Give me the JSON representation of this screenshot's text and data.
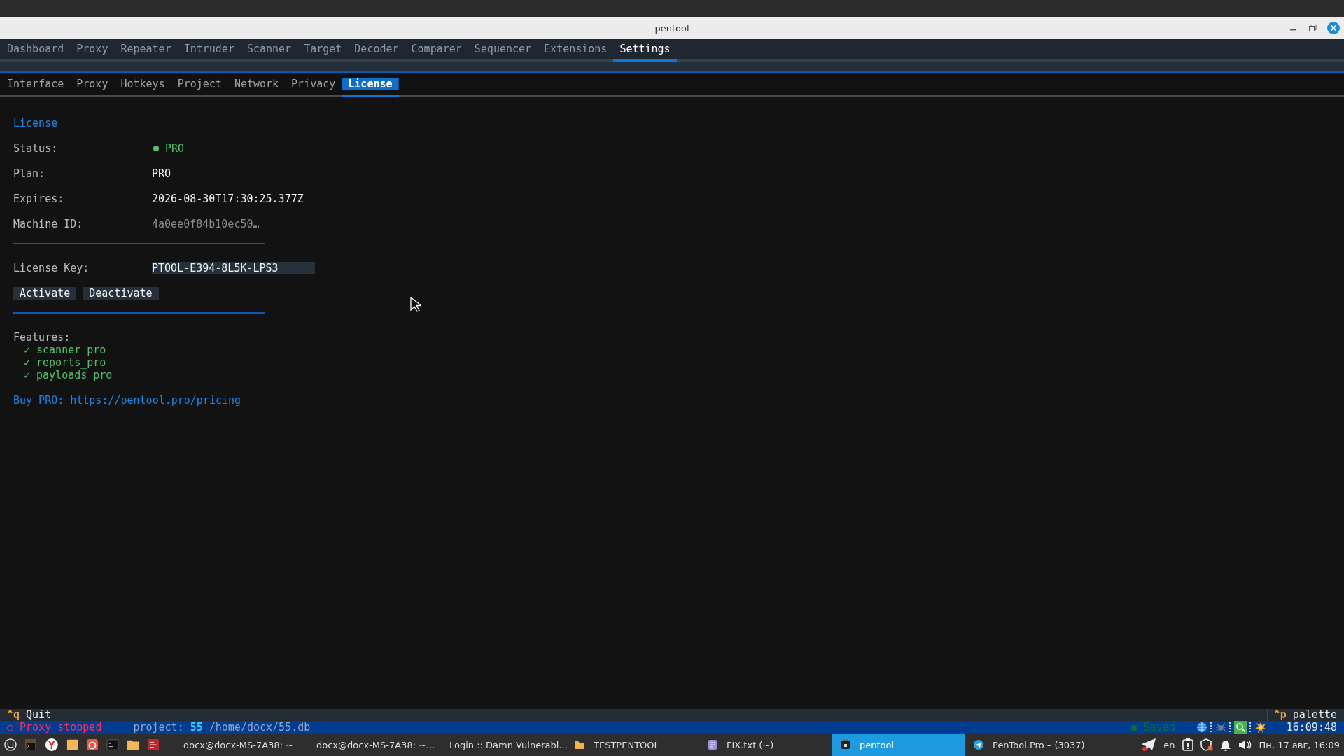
{
  "window": {
    "title": "pentool"
  },
  "main_tabs": [
    {
      "label": "Dashboard",
      "selected": false
    },
    {
      "label": "Proxy",
      "selected": false
    },
    {
      "label": "Repeater",
      "selected": false
    },
    {
      "label": "Intruder",
      "selected": false
    },
    {
      "label": "Scanner",
      "selected": false
    },
    {
      "label": "Target",
      "selected": false
    },
    {
      "label": "Decoder",
      "selected": false
    },
    {
      "label": "Comparer",
      "selected": false
    },
    {
      "label": "Sequencer",
      "selected": false
    },
    {
      "label": "Extensions",
      "selected": false
    },
    {
      "label": "Settings",
      "selected": true
    }
  ],
  "sub_tabs": [
    {
      "label": "Interface",
      "selected": false
    },
    {
      "label": "Proxy",
      "selected": false
    },
    {
      "label": "Hotkeys",
      "selected": false
    },
    {
      "label": "Project",
      "selected": false
    },
    {
      "label": "Network",
      "selected": false
    },
    {
      "label": "Privacy",
      "selected": false
    },
    {
      "label": "License",
      "selected": true
    }
  ],
  "license": {
    "heading": "License",
    "fields": [
      {
        "label": "Status:",
        "value": "PRO",
        "kind": "status"
      },
      {
        "label": "Plan:",
        "value": "PRO",
        "kind": "plain"
      },
      {
        "label": "Expires:",
        "value": "2026-08-30T17:30:25.377Z",
        "kind": "plain"
      },
      {
        "label": "Machine ID:",
        "value": "4a0ee0f84b10ec50…",
        "kind": "dim"
      }
    ],
    "key_label": "License Key:",
    "key_value": "PTOOL-E394-8L5K-LPS3",
    "buttons": [
      "Activate",
      "Deactivate"
    ],
    "features_heading": "Features:",
    "features": [
      {
        "mark": "✓",
        "name": "scanner_pro"
      },
      {
        "mark": "✓",
        "name": "reports_pro"
      },
      {
        "mark": "✓",
        "name": "payloads_pro"
      }
    ],
    "buy_label": "Buy PRO:",
    "buy_link": "https://pentool.pro/pricing"
  },
  "footer": {
    "quit_key": "^q",
    "quit_label": "Quit",
    "palette_key": "^p",
    "palette_label": "palette"
  },
  "status_bar": {
    "proxy_mark": "○",
    "proxy_text": "Proxy stopped",
    "proxy_running": false,
    "project_label": "project:",
    "project_id": "55",
    "project_path": "/home/docx/55.db",
    "saved_mark": "●",
    "saved_text": "Saved",
    "time": "16:09:48"
  },
  "taskbar": {
    "windows": [
      {
        "label": "docx@docx-MS-7A38: ~",
        "kind": "terminal",
        "selected": false
      },
      {
        "label": "docx@docx-MS-7A38: ~...",
        "kind": "terminal",
        "selected": false
      },
      {
        "label": "Login :: Damn Vulnerabl...",
        "kind": "browser",
        "selected": false
      },
      {
        "label": "TESTPENTOOL",
        "kind": "folder",
        "selected": false
      },
      {
        "label": "FIX.txt (~)",
        "kind": "text",
        "selected": false
      },
      {
        "label": "pentool",
        "kind": "app",
        "selected": true
      },
      {
        "label": "PenTool.Pro – (3037)",
        "kind": "chat",
        "selected": false
      }
    ],
    "language": "en",
    "clock": "Пн, 17 авг, 16:09"
  }
}
